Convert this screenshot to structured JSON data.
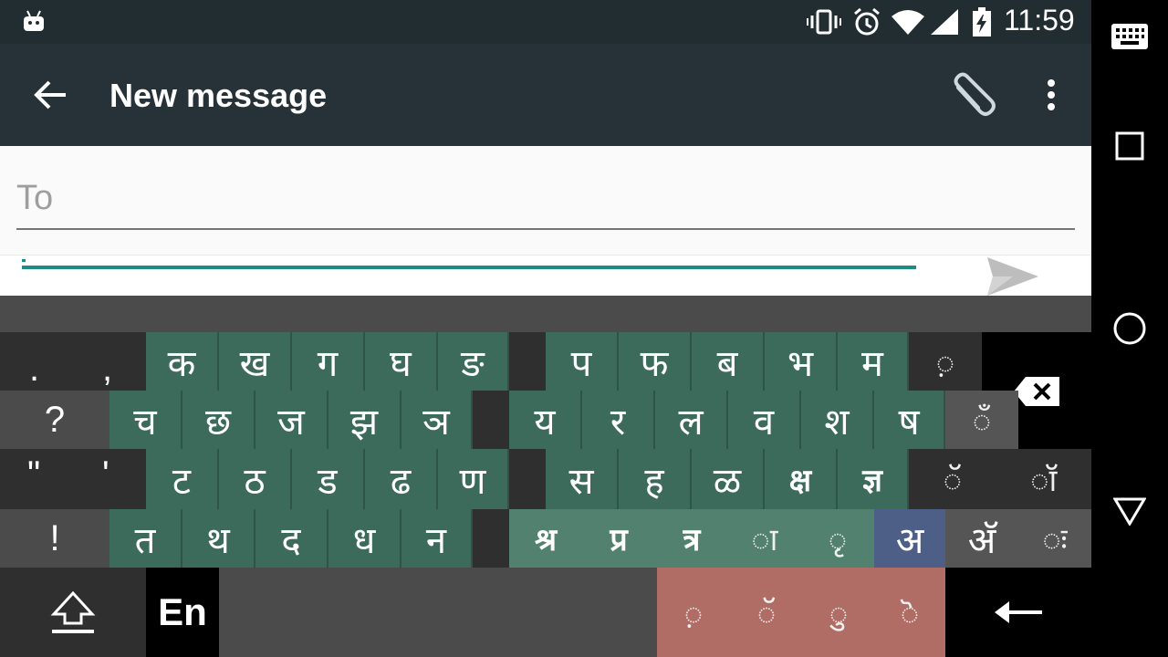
{
  "status_bar": {
    "time": "11:59"
  },
  "app_bar": {
    "title": "New message"
  },
  "compose": {
    "to_placeholder": "To"
  },
  "keyboard": {
    "row1": {
      "left": [
        ".",
        ","
      ],
      "consonants_a": [
        "क",
        "ख",
        "ग",
        "घ",
        "ङ"
      ],
      "consonants_b": [
        "प",
        "फ",
        "ब",
        "भ",
        "म"
      ],
      "extra": "◌़"
    },
    "row2": {
      "left": "?",
      "consonants_a": [
        "च",
        "छ",
        "ज",
        "झ",
        "ञ"
      ],
      "consonants_b": [
        "य",
        "र",
        "ल",
        "व",
        "श",
        "ष"
      ],
      "extra": "◌ँ"
    },
    "row3": {
      "left": [
        "\"",
        "'"
      ],
      "consonants_a": [
        "ट",
        "ठ",
        "ड",
        "ढ",
        "ण"
      ],
      "consonants_b": [
        "स",
        "ह",
        "ळ",
        "क्ष",
        "ज्ञ"
      ],
      "extra": [
        "◌ॅ",
        "◌ॉ"
      ]
    },
    "row4": {
      "left": "!",
      "consonants_a": [
        "त",
        "थ",
        "द",
        "ध",
        "न"
      ],
      "conjuncts": [
        "श्र",
        "प्र",
        "त्र",
        "◌ा",
        "◌ृ"
      ],
      "vowel_a": "अ",
      "vowel_ae": "अ‍ॅ",
      "visarga": "◌ः"
    },
    "row5": {
      "language": "En",
      "signs": [
        "◌़",
        "◌ॅ",
        "◌ु",
        "◌ॆ"
      ]
    }
  }
}
